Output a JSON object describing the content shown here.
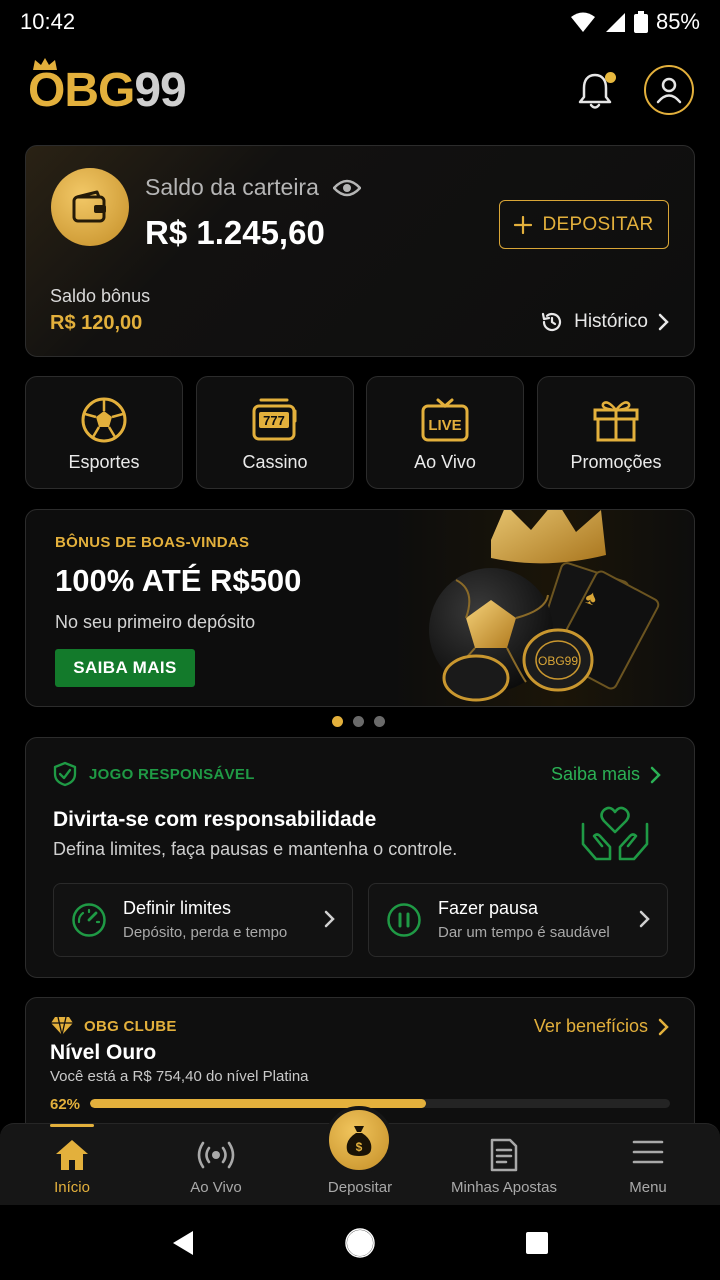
{
  "status": {
    "time": "10:42",
    "battery": "85%"
  },
  "brand": {
    "logo_part1": "OBG",
    "logo_part2": "99"
  },
  "wallet": {
    "label": "Saldo da carteira",
    "amount": "R$ 1.245,60",
    "deposit_label": "DEPOSITAR",
    "bonus_label": "Saldo bônus",
    "bonus_value": "R$ 120,00",
    "history_label": "Histórico"
  },
  "categories": [
    {
      "label": "Esportes",
      "icon": "soccer-ball-icon"
    },
    {
      "label": "Cassino",
      "icon": "slot-machine-icon"
    },
    {
      "label": "Ao Vivo",
      "icon": "live-tv-icon",
      "badge": "LIVE"
    },
    {
      "label": "Promoções",
      "icon": "gift-icon"
    }
  ],
  "promo": {
    "kicker": "BÔNUS DE BOAS-VINDAS",
    "title": "100% ATÉ R$500",
    "subtitle": "No seu primeiro depósito",
    "button": "SAIBA MAIS",
    "chip_text": "OBG99",
    "active_slide": 1,
    "slides": 3
  },
  "responsible": {
    "kicker": "JOGO RESPONSÁVEL",
    "more": "Saiba mais",
    "title": "Divirta-se com responsabilidade",
    "description": "Defina limites, faça pausas e mantenha o controle.",
    "options": [
      {
        "title": "Definir limites",
        "subtitle": "Depósito, perda e tempo",
        "icon": "gauge-icon"
      },
      {
        "title": "Fazer pausa",
        "subtitle": "Dar um tempo é saudável",
        "icon": "pause-icon"
      }
    ]
  },
  "club": {
    "kicker": "OBG CLUBE",
    "more": "Ver benefícios",
    "level": "Nível Ouro",
    "description": "Você está a R$ 754,40 do nível Platina",
    "progress_label": "62%",
    "progress": 0.58
  },
  "bottom_nav": [
    {
      "label": "Início",
      "icon": "home-icon",
      "active": true
    },
    {
      "label": "Ao Vivo",
      "icon": "broadcast-icon"
    },
    {
      "label": "Depositar",
      "icon": "money-bag-icon"
    },
    {
      "label": "Minhas Apostas",
      "icon": "receipt-icon"
    },
    {
      "label": "Menu",
      "icon": "hamburger-menu-icon"
    }
  ],
  "colors": {
    "gold": "#e3b03c",
    "green": "#1f9a45",
    "background": "#000000",
    "card": "#0f0f0f"
  }
}
